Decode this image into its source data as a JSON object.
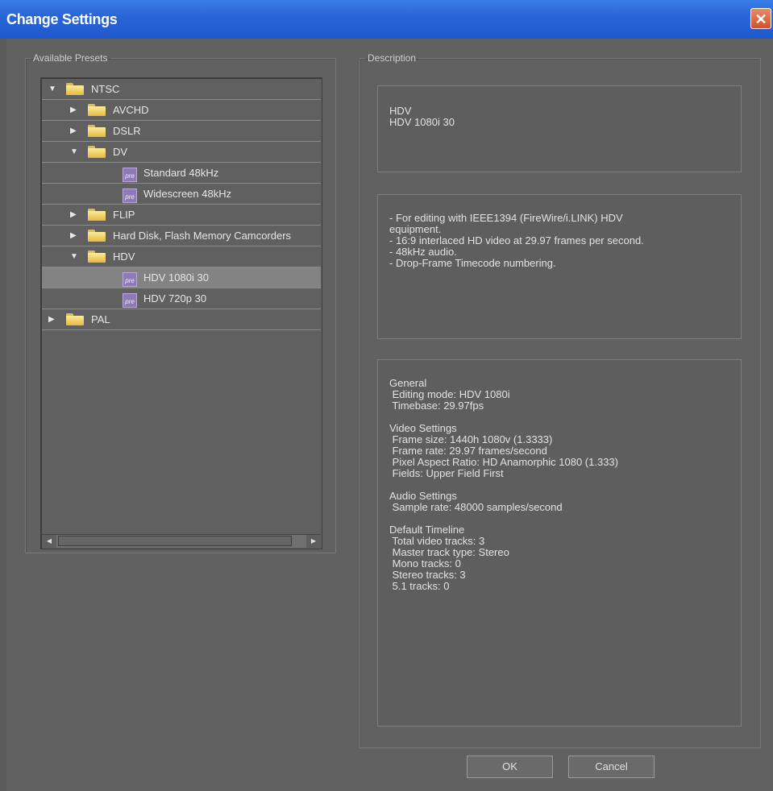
{
  "window": {
    "title": "Change Settings",
    "close_glyph": "✕"
  },
  "presets": {
    "legend": "Available Presets",
    "tree": [
      {
        "label": "NTSC",
        "level": 0,
        "expanded": true,
        "kind": "folder",
        "selected": false
      },
      {
        "label": "AVCHD",
        "level": 1,
        "expanded": false,
        "kind": "folder",
        "selected": false
      },
      {
        "label": "DSLR",
        "level": 1,
        "expanded": false,
        "kind": "folder",
        "selected": false
      },
      {
        "label": "DV",
        "level": 1,
        "expanded": true,
        "kind": "folder",
        "selected": false
      },
      {
        "label": "Standard 48kHz",
        "level": 2,
        "kind": "preset",
        "icon_text": "pre",
        "selected": false
      },
      {
        "label": "Widescreen 48kHz",
        "level": 2,
        "kind": "preset",
        "icon_text": "pre",
        "selected": false
      },
      {
        "label": "FLIP",
        "level": 1,
        "expanded": false,
        "kind": "folder",
        "selected": false
      },
      {
        "label": "Hard Disk, Flash Memory Camcorders",
        "level": 1,
        "expanded": false,
        "kind": "folder",
        "selected": false
      },
      {
        "label": "HDV",
        "level": 1,
        "expanded": true,
        "kind": "folder",
        "selected": false
      },
      {
        "label": "HDV 1080i 30",
        "level": 2,
        "kind": "preset",
        "icon_text": "pre",
        "selected": true
      },
      {
        "label": "HDV 720p 30",
        "level": 2,
        "kind": "preset",
        "icon_text": "pre",
        "selected": false
      },
      {
        "label": "PAL",
        "level": 0,
        "expanded": false,
        "kind": "folder",
        "selected": false
      }
    ]
  },
  "description": {
    "legend": "Description",
    "summary": "HDV\nHDV 1080i 30",
    "details": "- For editing with IEEE1394 (FireWire/i.LINK) HDV\nequipment.\n- 16:9 interlaced HD video at 29.97 frames per second.\n- 48kHz audio.\n- Drop-Frame Timecode numbering.",
    "settings": "General\n Editing mode: HDV 1080i\n Timebase: 29.97fps\n\nVideo Settings\n Frame size: 1440h 1080v (1.3333)\n Frame rate: 29.97 frames/second\n Pixel Aspect Ratio: HD Anamorphic 1080 (1.333)\n Fields: Upper Field First\n\nAudio Settings\n Sample rate: 48000 samples/second\n\nDefault Timeline\n Total video tracks: 3\n Master track type: Stereo\n Mono tracks: 0\n Stereo tracks: 3\n 5.1 tracks: 0"
  },
  "buttons": {
    "ok": "OK",
    "cancel": "Cancel"
  },
  "colors": {
    "titlebar": "#2a66d8",
    "background": "#616161",
    "selection": "#838383"
  }
}
